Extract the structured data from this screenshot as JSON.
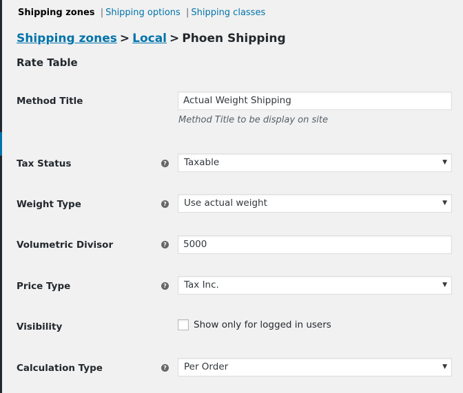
{
  "subnav": {
    "current": "Shipping zones",
    "links": [
      "Shipping options",
      "Shipping classes"
    ],
    "separator": "|"
  },
  "breadcrumb": {
    "zones": "Shipping zones",
    "zone": "Local",
    "method": "Phoen Shipping",
    "separator": ">"
  },
  "section_title": "Rate Table",
  "fields": {
    "method_title": {
      "label": "Method Title",
      "value": "Actual Weight Shipping",
      "description": "Method Title to be display on site"
    },
    "tax_status": {
      "label": "Tax Status",
      "value": "Taxable"
    },
    "weight_type": {
      "label": "Weight Type",
      "value": "Use actual weight"
    },
    "volumetric_divisor": {
      "label": "Volumetric Divisor",
      "value": "5000"
    },
    "price_type": {
      "label": "Price Type",
      "value": "Tax Inc."
    },
    "visibility": {
      "label": "Visibility",
      "checkbox_label": "Show only for logged in users",
      "checked": false
    },
    "calculation_type": {
      "label": "Calculation Type",
      "value": "Per Order"
    }
  },
  "icons": {
    "help": "help-tip-icon",
    "dropdown": "dropdown-caret-icon"
  },
  "glyphs": {
    "help": "?",
    "caret": "▼"
  },
  "colors": {
    "link": "#0073aa",
    "background": "#f1f1f1",
    "text": "#23282d"
  }
}
